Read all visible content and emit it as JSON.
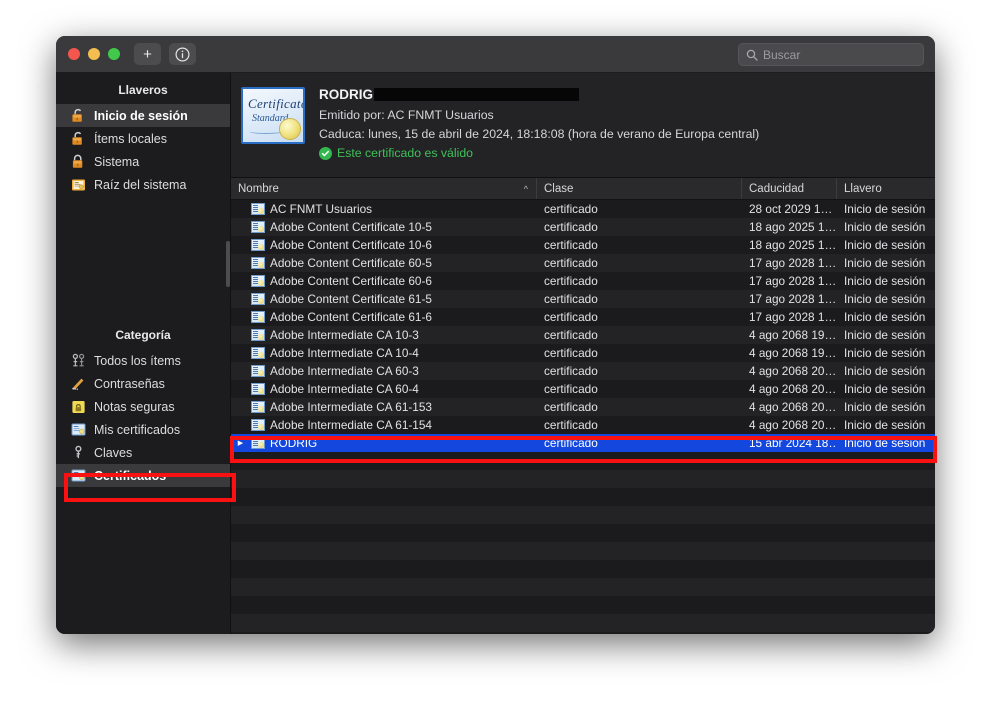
{
  "window": {
    "titlebar": {
      "traffic_lights": [
        "close",
        "minimize",
        "maximize"
      ],
      "add_button_label": "+",
      "add_button_icon": "plus-icon",
      "info_button_label": "ⓘ",
      "info_button_icon": "info-circle-icon",
      "colors": {
        "close": "#f2564c",
        "minimize": "#f4bd4f",
        "maximize": "#42c94c"
      }
    },
    "search": {
      "placeholder": "Buscar",
      "value": "",
      "icon": "search-icon"
    }
  },
  "sidebar": {
    "keychains_header": "Llaveros",
    "keychains": [
      {
        "label": "Inicio de sesión",
        "icon": "unlocked-keychain-icon",
        "selected": true
      },
      {
        "label": "Ítems locales",
        "icon": "unlocked-keychain-icon",
        "selected": false
      },
      {
        "label": "Sistema",
        "icon": "locked-keychain-icon",
        "selected": false
      },
      {
        "label": "Raíz del sistema",
        "icon": "system-root-certificate-icon",
        "selected": false
      }
    ],
    "category_header": "Categoría",
    "categories": [
      {
        "label": "Todos los ítems",
        "icon": "all-items-keys-icon",
        "selected": false
      },
      {
        "label": "Contraseñas",
        "icon": "password-pencil-icon",
        "selected": false
      },
      {
        "label": "Notas seguras",
        "icon": "secure-note-lock-icon",
        "selected": false
      },
      {
        "label": "Mis certificados",
        "icon": "my-certificates-icon",
        "selected": false
      },
      {
        "label": "Claves",
        "icon": "key-icon",
        "selected": false
      },
      {
        "label": "Certificados",
        "icon": "certificate-icon",
        "selected": true
      }
    ]
  },
  "detail": {
    "icon": "certificate-standard-badge-icon",
    "icon_text_line1": "Certificate",
    "icon_text_line2": "Standard",
    "cert_name": "RODRIG",
    "name_redacted": true,
    "issued_by": "Emitido por: AC FNMT Usuarios",
    "expires": "Caduca: lunes, 15 de abril de 2024, 18:18:08 (hora de verano de Europa central)",
    "validity": "Este certificado es válido",
    "validity_icon": "green-check-circle-icon",
    "validity_color": "#3fc05a"
  },
  "table": {
    "columns": [
      {
        "key": "name",
        "label": "Nombre",
        "sorted": "asc",
        "sort_icon": "chevron-up-icon"
      },
      {
        "key": "class",
        "label": "Clase",
        "sorted": ""
      },
      {
        "key": "expiry",
        "label": "Caducidad",
        "sorted": ""
      },
      {
        "key": "keychain",
        "label": "Llavero",
        "sorted": ""
      }
    ],
    "rows": [
      {
        "name": "AC FNMT Usuarios",
        "class": "certificado",
        "expiry": "28 oct 2029 1…",
        "keychain": "Inicio de sesión",
        "selected": false,
        "expandable": false
      },
      {
        "name": "Adobe Content Certificate 10-5",
        "class": "certificado",
        "expiry": "18 ago 2025 1…",
        "keychain": "Inicio de sesión",
        "selected": false,
        "expandable": false
      },
      {
        "name": "Adobe Content Certificate 10-6",
        "class": "certificado",
        "expiry": "18 ago 2025 1…",
        "keychain": "Inicio de sesión",
        "selected": false,
        "expandable": false
      },
      {
        "name": "Adobe Content Certificate 60-5",
        "class": "certificado",
        "expiry": "17 ago 2028 1…",
        "keychain": "Inicio de sesión",
        "selected": false,
        "expandable": false
      },
      {
        "name": "Adobe Content Certificate 60-6",
        "class": "certificado",
        "expiry": "17 ago 2028 1…",
        "keychain": "Inicio de sesión",
        "selected": false,
        "expandable": false
      },
      {
        "name": "Adobe Content Certificate 61-5",
        "class": "certificado",
        "expiry": "17 ago 2028 1…",
        "keychain": "Inicio de sesión",
        "selected": false,
        "expandable": false
      },
      {
        "name": "Adobe Content Certificate 61-6",
        "class": "certificado",
        "expiry": "17 ago 2028 1…",
        "keychain": "Inicio de sesión",
        "selected": false,
        "expandable": false
      },
      {
        "name": "Adobe Intermediate CA 10-3",
        "class": "certificado",
        "expiry": "4 ago 2068 19…",
        "keychain": "Inicio de sesión",
        "selected": false,
        "expandable": false
      },
      {
        "name": "Adobe Intermediate CA 10-4",
        "class": "certificado",
        "expiry": "4 ago 2068 19…",
        "keychain": "Inicio de sesión",
        "selected": false,
        "expandable": false
      },
      {
        "name": "Adobe Intermediate CA 60-3",
        "class": "certificado",
        "expiry": "4 ago 2068 20…",
        "keychain": "Inicio de sesión",
        "selected": false,
        "expandable": false
      },
      {
        "name": "Adobe Intermediate CA 60-4",
        "class": "certificado",
        "expiry": "4 ago 2068 20…",
        "keychain": "Inicio de sesión",
        "selected": false,
        "expandable": false
      },
      {
        "name": "Adobe Intermediate CA 61-153",
        "class": "certificado",
        "expiry": "4 ago 2068 20…",
        "keychain": "Inicio de sesión",
        "selected": false,
        "expandable": false
      },
      {
        "name": "Adobe Intermediate CA 61-154",
        "class": "certificado",
        "expiry": "4 ago 2068 20…",
        "keychain": "Inicio de sesión",
        "selected": false,
        "expandable": false
      },
      {
        "name": "RODRIG",
        "class": "certificado",
        "expiry": "15 abr 2024 18…",
        "keychain": "Inicio de sesión",
        "selected": true,
        "expandable": true
      }
    ],
    "empty_row_count": 10,
    "selection_color": "#1447dd"
  },
  "annotations": [
    {
      "name": "certificados-category-highlight",
      "color": "#fa1111"
    },
    {
      "name": "selected-certificate-row-highlight",
      "color": "#fa1111"
    }
  ]
}
